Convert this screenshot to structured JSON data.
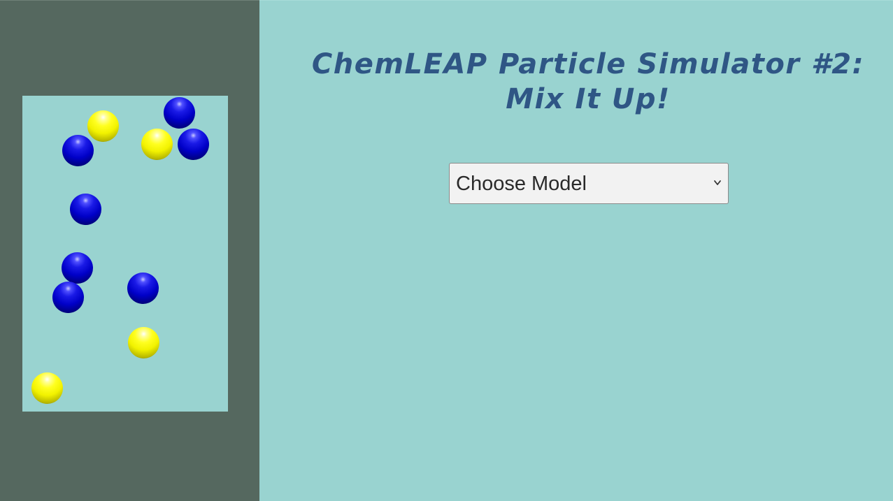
{
  "app": {
    "title": "ChemLEAP Particle Simulator #2:\nMix It Up!"
  },
  "model_select": {
    "selected": "Choose Model",
    "icon": "chevron-down-icon"
  },
  "simulation": {
    "particle_colors": {
      "blue": "#0000c8",
      "yellow": "#f2f200"
    },
    "particles": [
      {
        "color": "yellow"
      },
      {
        "color": "blue"
      },
      {
        "color": "blue"
      },
      {
        "color": "yellow"
      },
      {
        "color": "blue"
      },
      {
        "color": "blue"
      },
      {
        "color": "blue"
      },
      {
        "color": "blue"
      },
      {
        "color": "blue"
      },
      {
        "color": "yellow"
      },
      {
        "color": "yellow"
      }
    ]
  },
  "colors": {
    "left_panel_bg": "#55685f",
    "main_bg": "#99d3d0",
    "title_color": "#2f5685"
  }
}
